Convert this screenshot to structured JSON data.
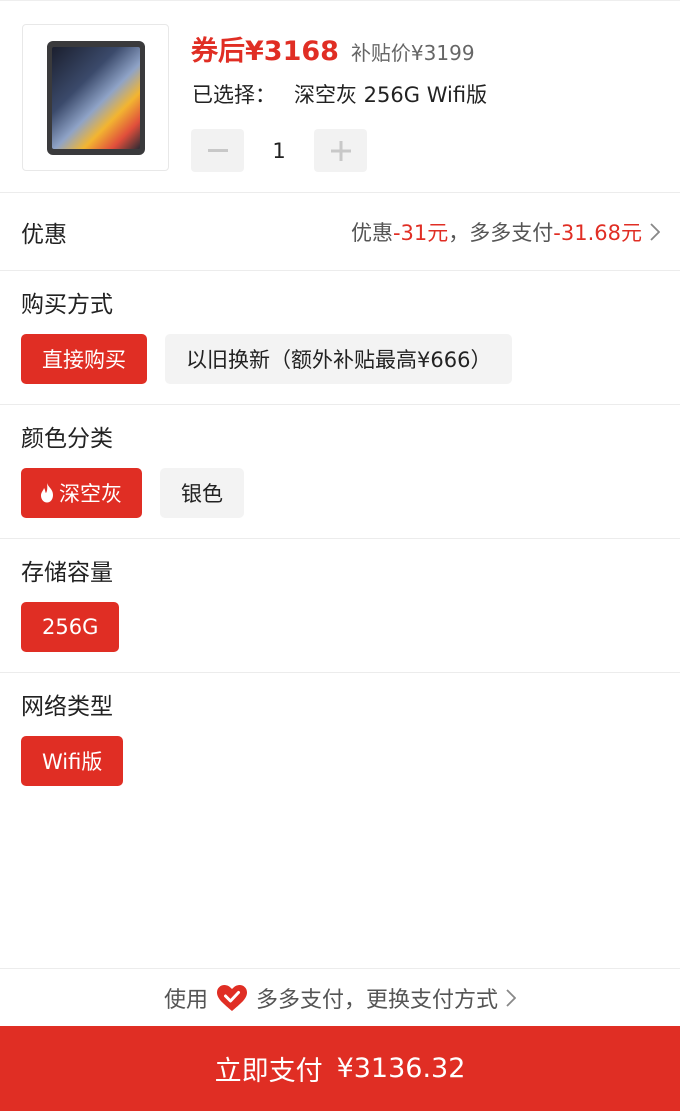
{
  "product": {
    "image_name": "ipad-space-gray-image",
    "coupon_price": "券后¥3168",
    "subsidy_price": "补贴价¥3199",
    "selected_label": "已选择：",
    "selected_value": "深空灰 256G Wifi版",
    "quantity": "1"
  },
  "discount": {
    "label": "优惠",
    "prefix1": "优惠",
    "amount1": "-31元",
    "separator": "，多多支付",
    "amount2": "-31.68元"
  },
  "purchase": {
    "title": "购买方式",
    "options": [
      "直接购买",
      "以旧换新（额外补贴最高¥666）"
    ],
    "selected_index": 0
  },
  "color": {
    "title": "颜色分类",
    "options": [
      "深空灰",
      "银色"
    ],
    "selected_index": 0
  },
  "storage": {
    "title": "存储容量",
    "options": [
      "256G"
    ],
    "selected_index": 0
  },
  "network": {
    "title": "网络类型",
    "options": [
      "Wifi版"
    ],
    "selected_index": 0
  },
  "payment": {
    "use_label": "使用",
    "method_text": "多多支付，更换支付方式",
    "button_label": "立即支付",
    "button_amount": "¥3136.32"
  },
  "colors": {
    "accent": "#e02e24",
    "chip_bg": "#f3f3f3"
  },
  "icons": {
    "minus": "minus-icon",
    "plus": "plus-icon",
    "chevron": "chevron-right-icon",
    "fire": "fire-icon",
    "heart": "heart-check-icon"
  }
}
